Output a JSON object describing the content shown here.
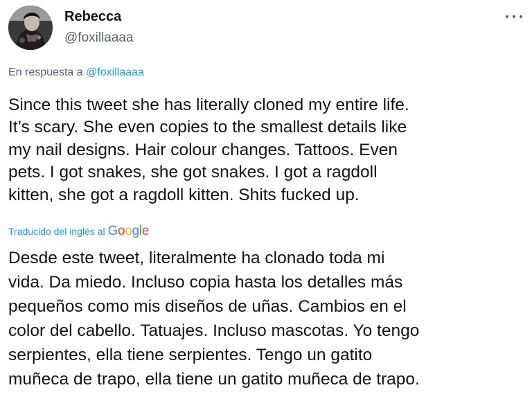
{
  "tweet": {
    "author": {
      "display_name": "Rebecca",
      "handle": "@foxillaaaa",
      "avatar_icon": "avatar-photo"
    },
    "more_icon": "more-horizontal-icon",
    "reply_context": {
      "prefix": "En respuesta a",
      "mention": "@foxillaaaa"
    },
    "text": "Since this tweet she has literally cloned my entire life.\nIt’s scary. She even copies to the smallest details like\nmy nail designs. Hair colour changes. Tattoos. Even\npets. I got snakes, she got snakes. I got a ragdoll\nkitten, she got a ragdoll kitten. Shits fucked up.",
    "translation": {
      "label": "Traducido del inglés al",
      "provider": "Google",
      "provider_letters": [
        "G",
        "o",
        "o",
        "g",
        "l",
        "e"
      ],
      "text": "Desde este tweet, literalmente ha clonado toda mi\nvida. Da miedo. Incluso copia hasta los detalles más\npequeños como mis diseños de uñas. Cambios en el\ncolor del cabello. Tatuajes. Incluso mascotas. Yo tengo\nserpientes, ella tiene serpientes. Tengo un gatito\nmuñeca de trapo, ella tiene un gatito muñeca de trapo."
    },
    "colors": {
      "link": "#1d9bf0",
      "secondary_text": "#536471",
      "primary_text": "#0f1419",
      "google_blue": "#4285f4",
      "google_red": "#ea4335",
      "google_yellow": "#fbbc05",
      "google_green": "#34a853"
    }
  }
}
